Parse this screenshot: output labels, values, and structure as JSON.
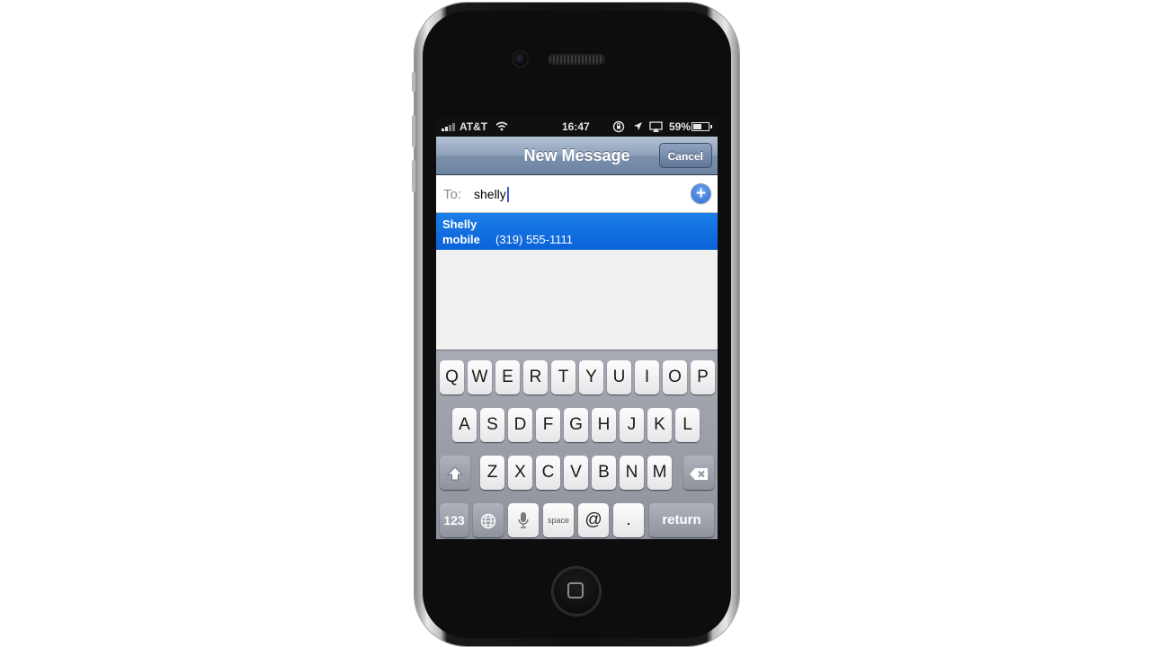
{
  "status_bar": {
    "carrier": "AT&T",
    "time": "16:47",
    "battery_percent": "59%",
    "battery_level": 0.59,
    "icons": [
      "signal-icon",
      "wifi-icon",
      "rotation-lock-icon",
      "location-icon",
      "airplay-icon",
      "battery-icon"
    ]
  },
  "nav": {
    "title": "New Message",
    "cancel_label": "Cancel"
  },
  "compose": {
    "to_label": "To:",
    "to_value": "shelly",
    "add_icon": "plus-circle-icon"
  },
  "suggestion": {
    "name": "Shelly",
    "type": "mobile",
    "phone": "(319) 555-1111"
  },
  "keyboard": {
    "row1": [
      "Q",
      "W",
      "E",
      "R",
      "T",
      "Y",
      "U",
      "I",
      "O",
      "P"
    ],
    "row2": [
      "A",
      "S",
      "D",
      "F",
      "G",
      "H",
      "J",
      "K",
      "L"
    ],
    "row3": [
      "Z",
      "X",
      "C",
      "V",
      "B",
      "N",
      "M"
    ],
    "numbers_label": "123",
    "space_label": "space",
    "at_label": "@",
    "dot_label": ".",
    "return_label": "return",
    "icons": [
      "shift-icon",
      "backspace-icon",
      "globe-icon",
      "microphone-icon"
    ]
  }
}
